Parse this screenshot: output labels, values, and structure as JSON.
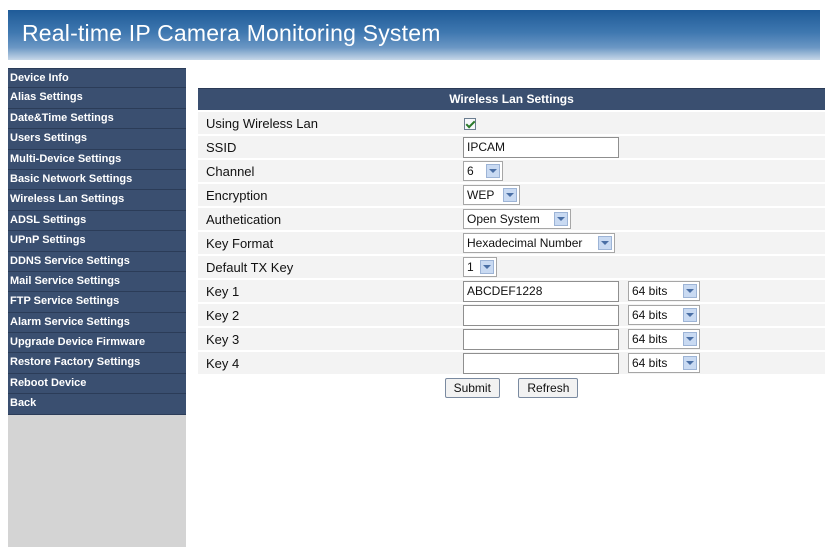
{
  "header": {
    "title": "Real-time IP Camera Monitoring System"
  },
  "sidebar": {
    "items": [
      "Device Info",
      "Alias Settings",
      "Date&Time Settings",
      "Users Settings",
      "Multi-Device Settings",
      "Basic Network Settings",
      "Wireless Lan Settings",
      "ADSL Settings",
      "UPnP Settings",
      "DDNS Service Settings",
      "Mail Service Settings",
      "FTP Service Settings",
      "Alarm Service Settings",
      "Upgrade Device Firmware",
      "Restore Factory Settings",
      "Reboot Device",
      "Back"
    ]
  },
  "panel": {
    "title": "Wireless Lan Settings",
    "using_wireless_label": "Using Wireless Lan",
    "using_wireless_checked": true,
    "ssid_label": "SSID",
    "ssid_value": "IPCAM",
    "channel_label": "Channel",
    "channel_value": "6",
    "encryption_label": "Encryption",
    "encryption_value": "WEP",
    "auth_label": "Authetication",
    "auth_value": "Open System",
    "key_format_label": "Key Format",
    "key_format_value": "Hexadecimal Number",
    "default_tx_label": "Default TX Key",
    "default_tx_value": "1",
    "keys": [
      {
        "label": "Key 1",
        "value": "ABCDEF1228",
        "bits": "64 bits"
      },
      {
        "label": "Key 2",
        "value": "",
        "bits": "64 bits"
      },
      {
        "label": "Key 3",
        "value": "",
        "bits": "64 bits"
      },
      {
        "label": "Key 4",
        "value": "",
        "bits": "64 bits"
      }
    ],
    "submit_label": "Submit",
    "refresh_label": "Refresh"
  },
  "colors": {
    "nav_bg": "#3a4f70",
    "header_blue": "#1f5b98",
    "row_bg": "#f3f3f3",
    "sidebar_bg": "#d4d4d4"
  }
}
